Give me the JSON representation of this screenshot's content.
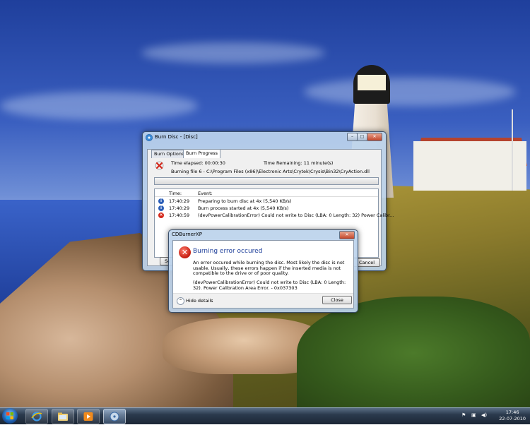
{
  "burn_window": {
    "title": "Burn Disc - [Disc]",
    "controls": [
      "–",
      "□",
      "✕"
    ],
    "tabs": [
      {
        "label": "Burn Options",
        "active": false
      },
      {
        "label": "Burn Progress",
        "active": true
      }
    ],
    "time_elapsed": "Time elapsed: 00:00:30",
    "time_remaining": "Time Remaining: 11 minute(s)",
    "burning_file": "Burning file 6 - C:\\Program Files (x86)\\Electronic Arts\\Crytek\\Crysis\\Bin32\\CryAction.dll",
    "progress": 0,
    "log": {
      "headers": [
        "Time:",
        "Event:"
      ],
      "rows": [
        {
          "icon": "info-icon",
          "time": "17:40:29",
          "event": "Preparing to burn disc at 4x (5,540 KB/s)"
        },
        {
          "icon": "info-icon",
          "time": "17:40:29",
          "event": "Burn process started at 4x (5,540 KB/s)"
        },
        {
          "icon": "error-icon",
          "time": "17:40:59",
          "event": "(devPowerCalibrationError)   Could not write to Disc (LBA: 0 Length: 32) Power Calibr..."
        }
      ]
    },
    "left_button_partial": "Se",
    "cancel_button": "Cancel"
  },
  "error_dialog": {
    "title": "CDBurnerXP",
    "heading": "Burning error occured",
    "message": "An error occured while burning the disc. Most likely the disc is not usable. Usually, these errors happen if the inserted media is not compatible to the drive or of poor quality.",
    "details": "(devPowerCalibrationError)   Could not write to Disc (LBA: 0 Length: 32). Power Calibration Area Error. - 0x037303",
    "hide_details": "Hide details",
    "close_button": "Close"
  },
  "taskbar": {
    "buttons": [
      "internet-explorer",
      "windows-explorer",
      "media-player",
      "cdburnerxp"
    ],
    "tray_icons": [
      "action-center-flag-icon",
      "network-icon",
      "volume-icon"
    ],
    "time": "17:46",
    "date": "22-07-2010"
  }
}
